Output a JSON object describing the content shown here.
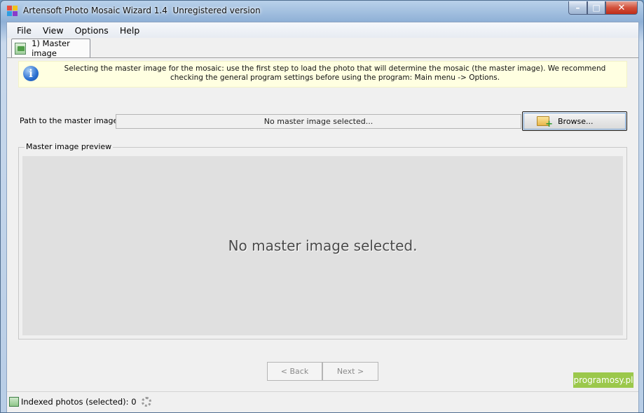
{
  "window": {
    "title": "Artensoft Photo Mosaic Wizard 1.4  Unregistered version",
    "minimize_glyph": "–",
    "maximize_glyph": "□",
    "close_glyph": "✕"
  },
  "menu": {
    "items": [
      {
        "label": "File"
      },
      {
        "label": "View"
      },
      {
        "label": "Options"
      },
      {
        "label": "Help"
      }
    ]
  },
  "tabs": [
    {
      "label": "1) Master image",
      "icon": "master-image-icon"
    }
  ],
  "info": {
    "icon": "info-icon",
    "icon_glyph": "i",
    "text": "Selecting the master image for the mosaic: use the first step to load the photo that will determine the mosaic (the master image). We recommend checking the general program settings before using the program: Main menu -> Options."
  },
  "path": {
    "label": "Path to the master image:",
    "value": "No master image selected..."
  },
  "browse": {
    "label": "Browse...",
    "icon": "folder-add-icon"
  },
  "preview": {
    "legend": "Master image preview",
    "placeholder": "No master image selected."
  },
  "navigation": {
    "back_label": "< Back",
    "next_label": "Next >"
  },
  "status": {
    "text": "Indexed photos (selected): 0",
    "icon": "indexed-photos-icon",
    "spinner": "loading-spinner-icon"
  },
  "watermark": {
    "text": "programosy.pl",
    "color": "#9bc84b"
  }
}
